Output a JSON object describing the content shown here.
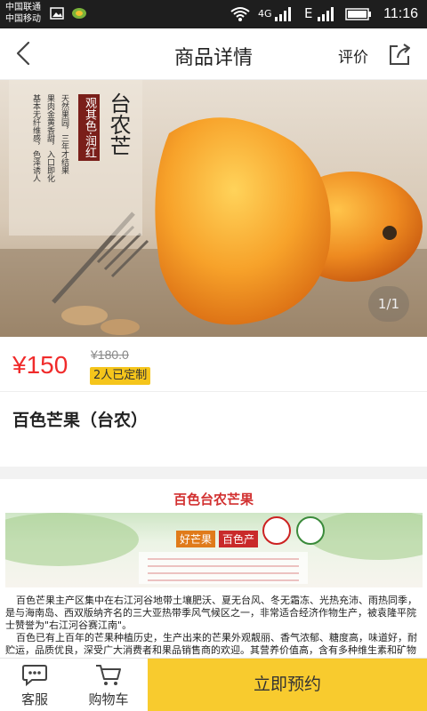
{
  "status_bar": {
    "carrier_1": "中国联通",
    "carrier_2": "中国移动",
    "network_1": "4G",
    "network_2": "E",
    "time": "11:16"
  },
  "header": {
    "title": "商品详情",
    "review_label": "评价"
  },
  "hero": {
    "image_text_title": "台农芒",
    "image_text_slogan": "观其色·润红",
    "image_text_lines": [
      "天然果园，三年才结果",
      "果肉金黄香甜，入口即化",
      "基本无纤维感，色泽诱人"
    ],
    "pager": "1/1"
  },
  "product": {
    "price": "¥150",
    "original_price": "¥180.0",
    "reserved_badge": "2人已定制",
    "name": "百色芒果（台农）"
  },
  "detail": {
    "heading": "百色台农芒果",
    "banner_slogan_1": "好芒果",
    "banner_slogan_2": "百色产",
    "paragraph_1": "百色芒果主产区集中在右江河谷地带土壤肥沃、夏无台风、冬无霜冻、光热充沛、雨热同季，是与海南岛、西双版纳齐名的三大亚热带季风气候区之一，非常适合经济作物生产，被袁隆平院士赞誉为\"右江河谷赛江南\"。",
    "paragraph_2": "百色已有上百年的芒果种植历史，生产出来的芒果外观靓丽、香气浓郁、糖度高，味道好，耐贮运，品质优良，深受广大消费者和果品销售商的欢迎。其营养价值高，含有多种维生素和矿物质。百色芒果具有无污染、品质好、色泽鲜艳等特点。"
  },
  "bottom_bar": {
    "service_label": "客服",
    "cart_label": "购物车",
    "reserve_label": "立即预约"
  },
  "colors": {
    "price_red": "#f02b2b",
    "badge_yellow": "#f5c51b",
    "reserve_yellow": "#f8cb2e",
    "heading_red": "#d23030"
  }
}
